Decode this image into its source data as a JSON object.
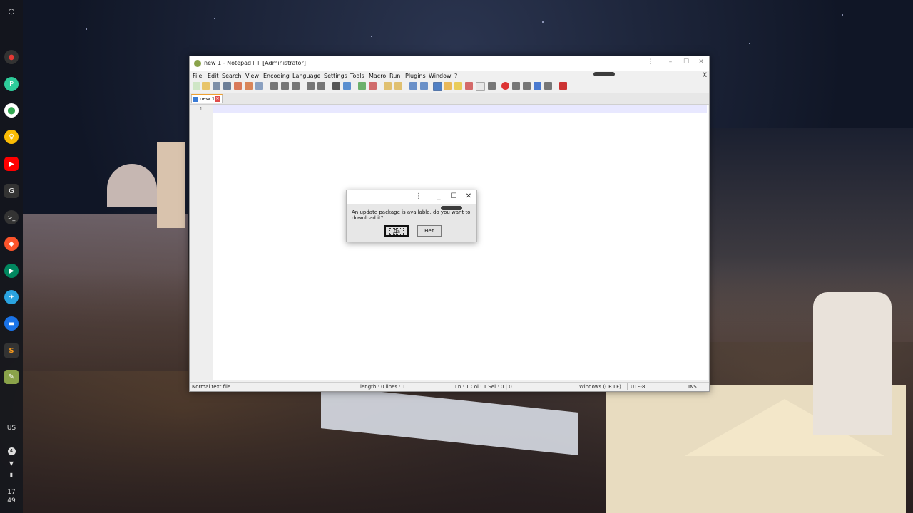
{
  "shelf": {
    "items": [
      {
        "name": "launcher-icon",
        "glyph": "○",
        "color": "#ffffff"
      },
      {
        "name": "screen-recorder-icon",
        "glyph": "●",
        "color": "#e53935"
      },
      {
        "name": "app-p-icon",
        "glyph": "P",
        "color": "#2ecc9a"
      },
      {
        "name": "maps-icon",
        "glyph": "⬤",
        "color": "#34a853"
      },
      {
        "name": "keep-icon",
        "glyph": "♀",
        "color": "#fbbc04"
      },
      {
        "name": "youtube-icon",
        "glyph": "▶",
        "color": "#ff0000"
      },
      {
        "name": "app-g-icon",
        "glyph": "G",
        "color": "#333333"
      },
      {
        "name": "terminal-icon",
        "glyph": ">_",
        "color": "#333333"
      },
      {
        "name": "brave-icon",
        "glyph": "◆",
        "color": "#fb542b"
      },
      {
        "name": "play-store-icon",
        "glyph": "▶",
        "color": "#01875f"
      },
      {
        "name": "telegram-icon",
        "glyph": "✈",
        "color": "#2aa3e0"
      },
      {
        "name": "files-icon",
        "glyph": "▬",
        "color": "#1a73e8"
      },
      {
        "name": "sublime-icon",
        "glyph": "S",
        "color": "#f89a1c"
      },
      {
        "name": "notepadpp-icon",
        "glyph": "✎",
        "color": "#8aa34a"
      }
    ],
    "ime_label": "US",
    "notification_count": "4",
    "clock_hour": "17",
    "clock_minute": "49"
  },
  "window": {
    "title": "new 1 - Notepad++ [Administrator]",
    "controls": {
      "more": "⋮",
      "minimize": "–",
      "maximize": "☐",
      "close": "✕"
    },
    "menu": [
      "File",
      "Edit",
      "Search",
      "View",
      "Encoding",
      "Language",
      "Settings",
      "Tools",
      "Macro",
      "Run",
      "Plugins",
      "Window",
      "?"
    ],
    "menu_close": "X",
    "tab_label": "new 1",
    "line_number": "1",
    "status": {
      "file_type": "Normal text file",
      "length_lines": "length : 0    lines : 1",
      "position": "Ln : 1    Col : 1    Sel : 0 | 0",
      "eol": "Windows (CR LF)",
      "encoding": "UTF-8",
      "mode": "INS"
    }
  },
  "dialog": {
    "controls": {
      "more": "⋮",
      "minimize": "_",
      "maximize": "☐",
      "close": "✕"
    },
    "message": "An update package is available, do you want to download it?",
    "yes_label": "Да",
    "no_label": "Нет"
  }
}
